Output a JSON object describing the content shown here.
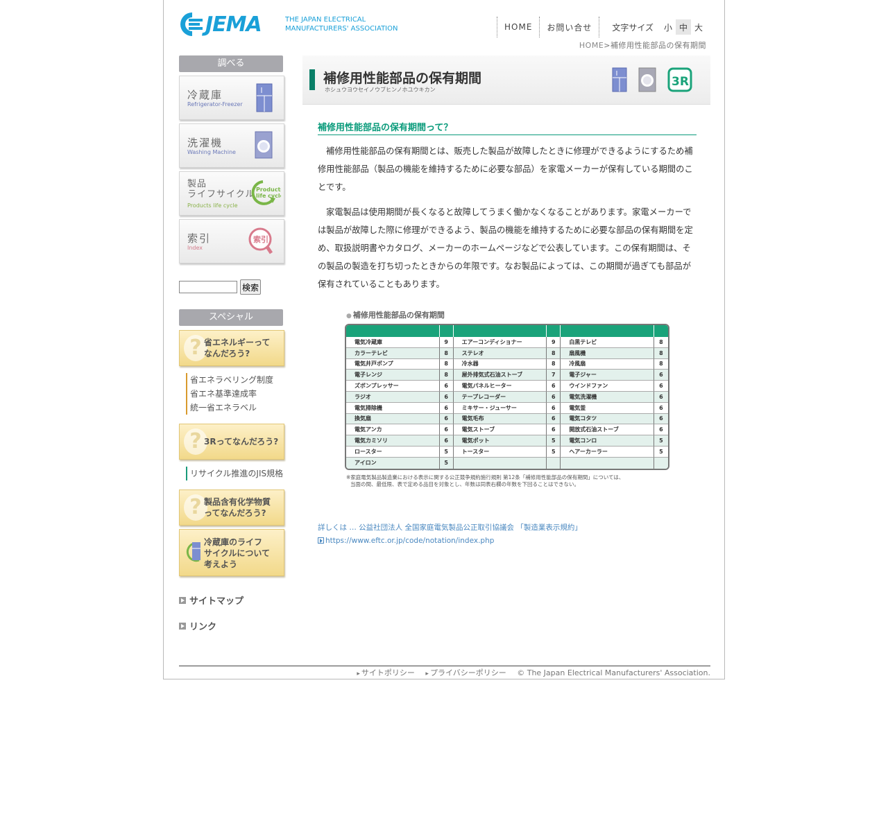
{
  "header": {
    "logo_text": "JEMA",
    "logo_sub_line1": "THE JAPAN ELECTRICAL",
    "logo_sub_line2": "MANUFACTURERS' ASSOCIATION",
    "nav_home": "HOME",
    "nav_contact": "お問い合せ",
    "font_size_label": "文字サイズ",
    "font_sizes": [
      "小",
      "中",
      "大"
    ],
    "font_size_selected": "中",
    "breadcrumb_home": "HOME",
    "breadcrumb_sep": ">",
    "breadcrumb_current": "補修用性能部品の保有期間"
  },
  "sidebar": {
    "search_head": "調べる",
    "categories": [
      {
        "jp": "冷蔵庫",
        "en": "Refrigerator-Freezer",
        "icon": "refrigerator-icon"
      },
      {
        "jp": "洗濯機",
        "en": "Washing Machine",
        "icon": "washing-machine-icon"
      },
      {
        "jp1": "製品",
        "jp2": "ライフサイクル",
        "en": "Products life cycle",
        "icon": "products-life-cycle-icon",
        "badge1": "Products",
        "badge2": "life cycle"
      },
      {
        "jp": "索引",
        "en": "Index",
        "icon": "index-magnifier-icon",
        "badge": "索引"
      }
    ],
    "search_placeholder": "",
    "search_button": "検索",
    "special_head": "スペシャル",
    "promo1": {
      "line1": "省エネルギーって",
      "line2": "なんだろう?"
    },
    "promo1_links": [
      "省エネラベリング制度",
      "省エネ基準達成率",
      "統一省エネラベル"
    ],
    "promo2": {
      "line1": "3Rってなんだろう?"
    },
    "promo2_links": [
      "リサイクル推進のJIS規格"
    ],
    "promo3": {
      "line1": "製品含有化学物質",
      "line2": "ってなんだろう?"
    },
    "promo4": {
      "line1": "冷蔵庫のライフ",
      "line2": "サイクルについて",
      "line3": "考えよう"
    },
    "sitemap": "サイトマップ",
    "link": "リンク"
  },
  "main": {
    "title": "補修用性能部品の保有期間",
    "title_ruby": "ホシュウヨウセイノウブヒンノホユウキカン",
    "section_title": "補修用性能部品の保有期間って？",
    "para1": "補修用性能部品の保有期間とは、販売した製品が故障したときに修理ができるようにするため補修用性能部品（製品の機能を維持するために必要な部品）を家電メーカーが保有している期間のことです。",
    "para2": "家電製品は使用期間が長くなると故障してうまく働かなくなることがあります。家電メーカーでは製品が故障した際に修理ができるよう、製品の機能を維持するために必要な部品の保有期間を定め、取扱説明書やカタログ、メーカーのホームページなどで公表しています。この保有期間は、その製品の製造を打ち切ったときからの年限です。なお製品によっては、この期間が過ぎても部品が保有されていることもあります。",
    "table_title": "補修用性能部品の保有期間",
    "table_rows": [
      [
        "電気冷蔵庫",
        "9",
        "エアーコンディショナー",
        "9",
        "白黒テレビ",
        "8"
      ],
      [
        "カラーテレビ",
        "8",
        "ステレオ",
        "8",
        "扇風機",
        "8"
      ],
      [
        "電気井戸ポンプ",
        "8",
        "冷水器",
        "8",
        "冷風扇",
        "8"
      ],
      [
        "電子レンジ",
        "8",
        "屋外排気式石油ストーブ",
        "7",
        "電子ジャー",
        "6"
      ],
      [
        "ズボンプレッサー",
        "6",
        "電気パネルヒーター",
        "6",
        "ウインドファン",
        "6"
      ],
      [
        "ラジオ",
        "6",
        "テープレコーダー",
        "6",
        "電気洗濯機",
        "6"
      ],
      [
        "電気掃除機",
        "6",
        "ミキサー・ジューサー",
        "6",
        "電気釜",
        "6"
      ],
      [
        "換気扇",
        "6",
        "電気毛布",
        "6",
        "電気コタツ",
        "6"
      ],
      [
        "電気アンカ",
        "6",
        "電気ストーブ",
        "6",
        "開放式石油ストーブ",
        "6"
      ],
      [
        "電気カミソリ",
        "6",
        "電気ポット",
        "5",
        "電気コンロ",
        "5"
      ],
      [
        "ロースター",
        "5",
        "トースター",
        "5",
        "ヘアーカーラー",
        "5"
      ],
      [
        "アイロン",
        "5",
        "",
        "",
        "",
        ""
      ]
    ],
    "table_note1": "※家庭電気製品製造業における表示に関する公正競争規約施行規則 第12条「補修用性能部品の保有期間」については、",
    "table_note2": "当面の間、最低限、表で定める品目を対象とし、年数は同表右欄の年数を下回ることはできない。",
    "ref_text": "詳しくは … 公益社団法人 全国家庭電気製品公正取引協議会 「製造業表示規約」",
    "ref_url": "https://www.eftc.or.jp/code/notation/index.php"
  },
  "footer": {
    "site_policy": "サイトポリシー",
    "privacy": "プライバシーポリシー",
    "copyright": "© The Japan Electrical Manufacturers' Association."
  },
  "colors": {
    "brand": "#1aa0d8",
    "accent": "#0a9b7b",
    "table_header": "#1aa37a"
  }
}
